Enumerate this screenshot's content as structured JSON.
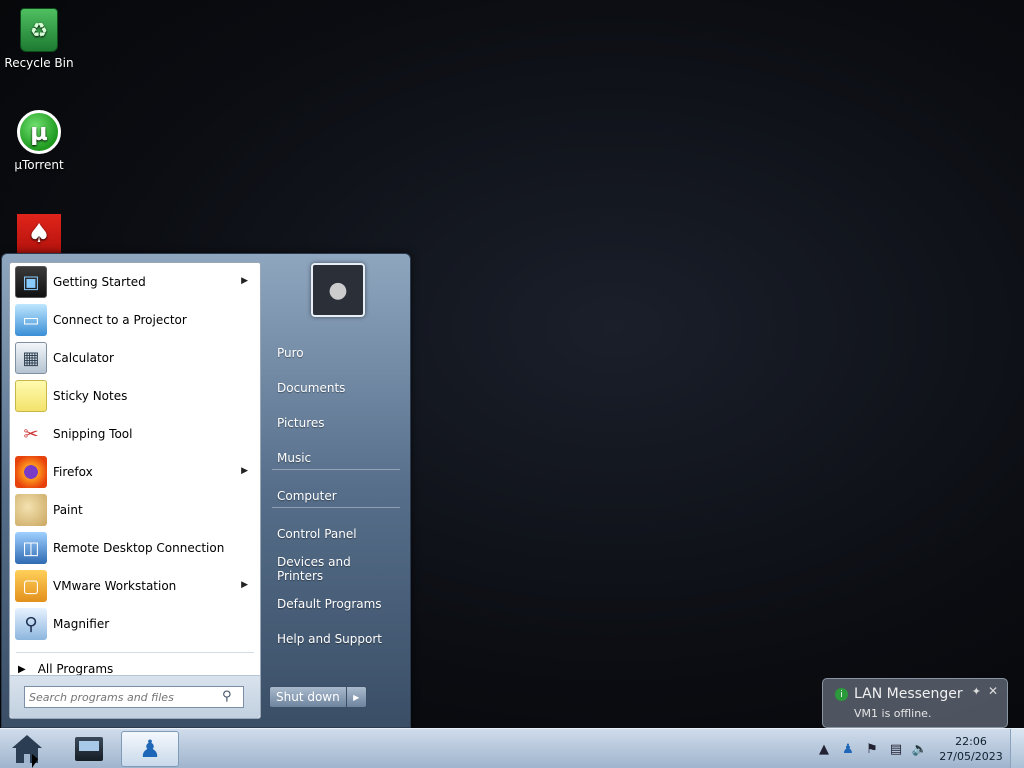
{
  "desktop": {
    "icons": [
      {
        "label": "Recycle Bin",
        "icon": "recycle-bin-icon"
      },
      {
        "label": "µTorrent",
        "icon": "utorrent-icon"
      },
      {
        "label": "",
        "icon": "acrobat-icon"
      }
    ]
  },
  "start_menu": {
    "programs": [
      {
        "label": "Getting Started",
        "icon": "getting-started-icon",
        "submenu": true
      },
      {
        "label": "Connect to a Projector",
        "icon": "projector-icon",
        "submenu": false
      },
      {
        "label": "Calculator",
        "icon": "calculator-icon",
        "submenu": false
      },
      {
        "label": "Sticky Notes",
        "icon": "sticky-notes-icon",
        "submenu": false
      },
      {
        "label": "Snipping Tool",
        "icon": "snipping-tool-icon",
        "submenu": false
      },
      {
        "label": "Firefox",
        "icon": "firefox-icon",
        "submenu": true
      },
      {
        "label": "Paint",
        "icon": "paint-icon",
        "submenu": false
      },
      {
        "label": "Remote Desktop Connection",
        "icon": "remote-desktop-icon",
        "submenu": false
      },
      {
        "label": "VMware Workstation",
        "icon": "vmware-icon",
        "submenu": true
      },
      {
        "label": "Magnifier",
        "icon": "magnifier-icon",
        "submenu": false
      }
    ],
    "all_programs": "All Programs",
    "search_placeholder": "Search programs and files",
    "places": [
      "Puro",
      "Documents",
      "Pictures",
      "Music",
      "Computer",
      "Control Panel",
      "Devices and Printers",
      "Default Programs",
      "Help and Support"
    ],
    "shutdown_label": "Shut down"
  },
  "notification": {
    "title": "LAN Messenger",
    "message": "VM1 is offline."
  },
  "taskbar": {
    "pinned": [
      {
        "name": "explorer-icon",
        "active": false
      },
      {
        "name": "lan-messenger-icon",
        "active": true
      }
    ],
    "tray_icons": [
      "show-hidden-icons-icon",
      "lan-messenger-tray-icon",
      "action-center-flag-icon",
      "network-icon",
      "volume-muted-icon"
    ],
    "clock": {
      "time": "22:06",
      "date": "27/05/2023"
    }
  }
}
